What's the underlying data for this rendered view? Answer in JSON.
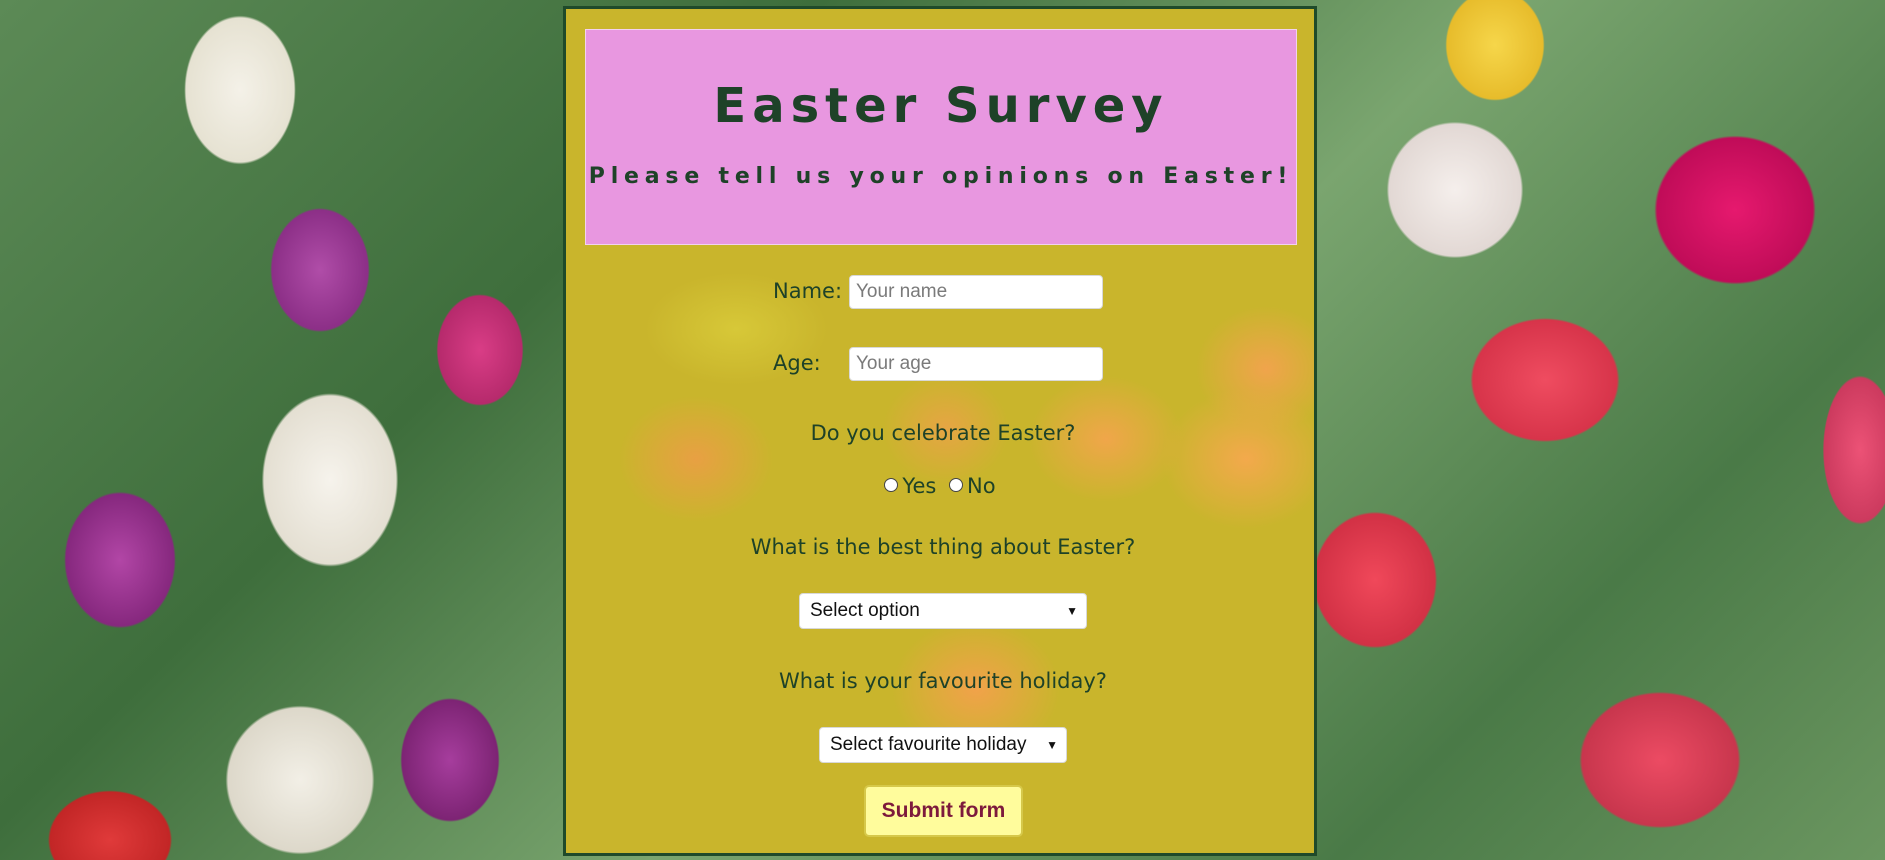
{
  "header": {
    "title": "Easter Survey",
    "subtitle": "Please tell us your opinions on Easter!"
  },
  "form": {
    "name": {
      "label": "Name:",
      "placeholder": "Your name"
    },
    "age": {
      "label": "Age:",
      "placeholder": "Your age"
    },
    "celebrate": {
      "question": "Do you celebrate Easter?",
      "options": [
        "Yes",
        "No"
      ]
    },
    "best_thing": {
      "question": "What is the best thing about Easter?",
      "selected": "Select option"
    },
    "favourite_holiday": {
      "question": "What is your favourite holiday?",
      "selected": "Select favourite holiday"
    },
    "submit_label": "Submit form"
  },
  "colors": {
    "header_bg": "#e897e0",
    "panel_bg": "#c9b52c",
    "text": "#1e4228",
    "submit_bg": "#fffc9c",
    "submit_text": "#7d1a3c"
  }
}
